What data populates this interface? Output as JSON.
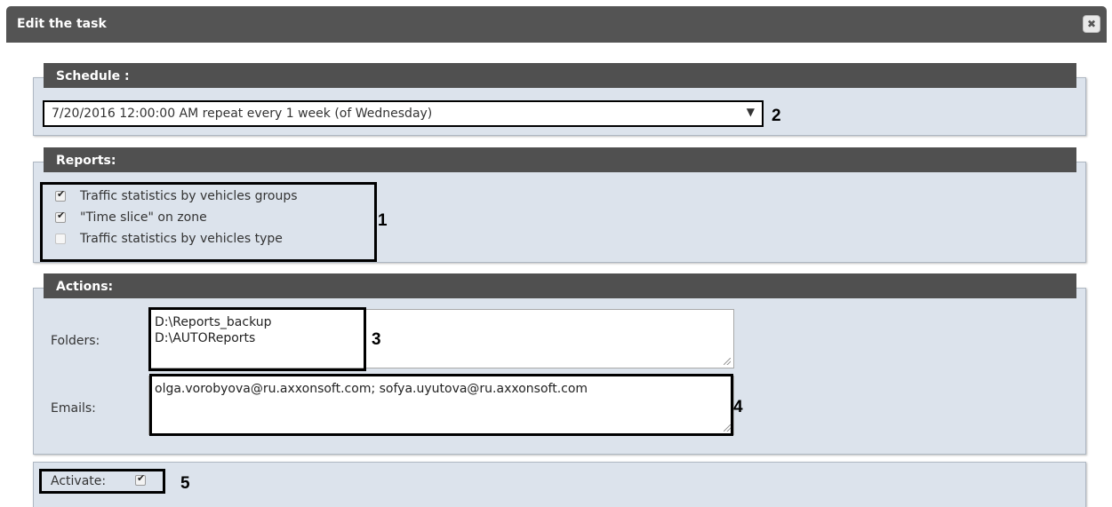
{
  "dialog": {
    "title": "Edit the task",
    "close_label": "✖"
  },
  "schedule": {
    "header": "Schedule :",
    "selected_value": "7/20/2016 12:00:00 AM repeat every 1 week (of Wednesday)",
    "marker": "2"
  },
  "reports": {
    "header": "Reports:",
    "marker": "1",
    "items": [
      {
        "label": "Traffic statistics by vehicles groups",
        "checked": true
      },
      {
        "label": "\"Time slice\" on zone",
        "checked": true
      },
      {
        "label": "Traffic statistics by vehicles type",
        "checked": false
      }
    ]
  },
  "actions": {
    "header": "Actions:",
    "folders_label": "Folders:",
    "folders_value": "D:\\Reports_backup\nD:\\AUTOReports",
    "folders_marker": "3",
    "emails_label": "Emails:",
    "emails_value": "olga.vorobyova@ru.axxonsoft.com; sofya.uyutova@ru.axxonsoft.com",
    "emails_marker": "4"
  },
  "activate": {
    "label": "Activate:",
    "checked": true,
    "marker": "5"
  }
}
